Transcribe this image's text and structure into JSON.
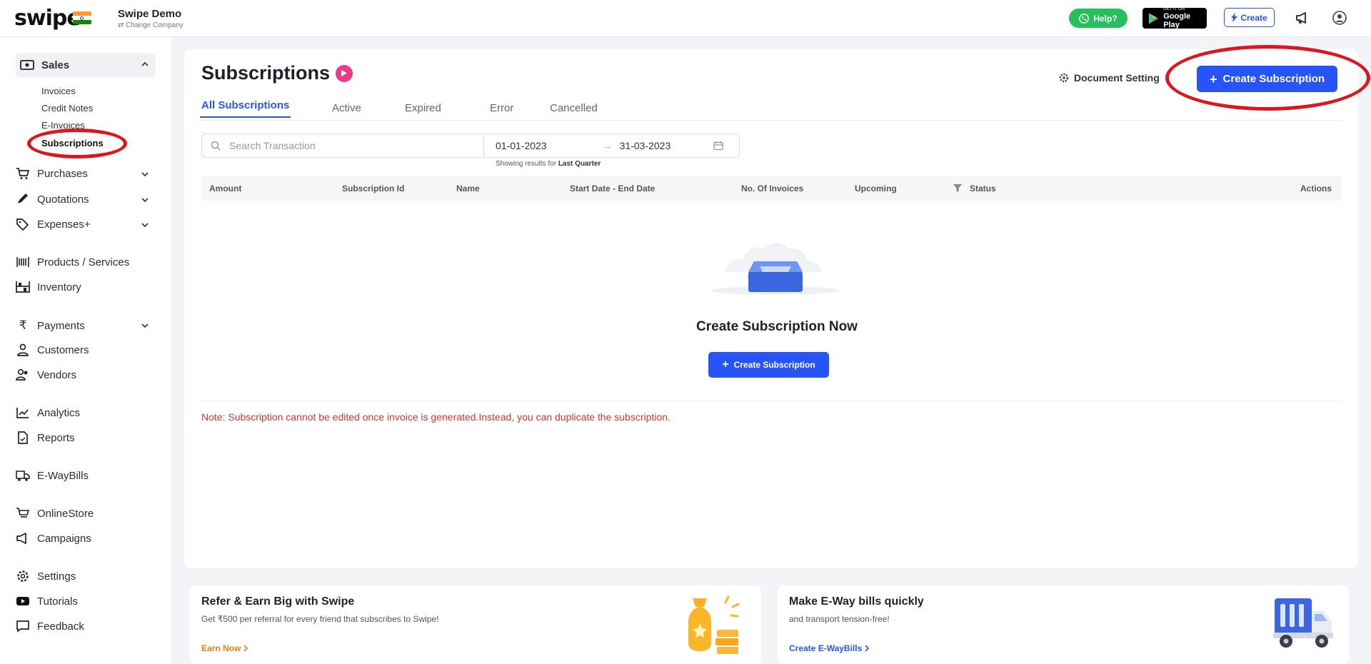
{
  "topbar": {
    "logo": "swipe",
    "company_name": "Swipe Demo",
    "change_company": "Change Company",
    "help_label": "Help?",
    "gplay_small": "GET IT ON",
    "gplay_label": "Google Play",
    "create_label": "Create"
  },
  "sidebar": {
    "sales": "Sales",
    "sales_sub": [
      "Invoices",
      "Credit Notes",
      "E-Invoices",
      "Subscriptions"
    ],
    "items": [
      {
        "label": "Purchases",
        "icon": "cart-icon"
      },
      {
        "label": "Quotations",
        "icon": "pencil-icon"
      },
      {
        "label": "Expenses+",
        "icon": "tag-icon"
      },
      {
        "label": "Products / Services",
        "icon": "barcode-icon"
      },
      {
        "label": "Inventory",
        "icon": "inventory-icon"
      },
      {
        "label": "Payments",
        "icon": "rupee-icon"
      },
      {
        "label": "Customers",
        "icon": "user-icon"
      },
      {
        "label": "Vendors",
        "icon": "users-icon"
      },
      {
        "label": "Analytics",
        "icon": "chart-icon"
      },
      {
        "label": "Reports",
        "icon": "report-icon"
      },
      {
        "label": "E-WayBills",
        "icon": "truck-icon"
      },
      {
        "label": "OnlineStore",
        "icon": "store-icon"
      },
      {
        "label": "Campaigns",
        "icon": "megaphone-icon"
      },
      {
        "label": "Settings",
        "icon": "gear-icon"
      },
      {
        "label": "Tutorials",
        "icon": "youtube-icon"
      },
      {
        "label": "Feedback",
        "icon": "feedback-icon"
      }
    ]
  },
  "page": {
    "title": "Subscriptions",
    "document_settings": "Document Setting",
    "create_subscription": "Create Subscription",
    "tabs": [
      "All Subscriptions",
      "Active",
      "Expired",
      "Error",
      "Cancelled"
    ],
    "search_placeholder": "Search Transaction",
    "date_from": "01-01-2023",
    "date_to": "31-03-2023",
    "showing_prefix": "Showing results for",
    "showing_value": "Last Quarter",
    "columns": [
      "Amount",
      "Subscription Id",
      "Name",
      "Start Date - End Date",
      "No. Of Invoices",
      "Upcoming",
      "Status",
      "Actions"
    ],
    "empty_title": "Create Subscription Now",
    "empty_button": "Create Subscription",
    "note": "Note: Subscription cannot be edited once invoice is generated.Instead, you can duplicate the subscription."
  },
  "cards": [
    {
      "title": "Refer & Earn Big with Swipe",
      "desc": "Get ₹500 per referral for every friend that subscribes to Swipe!",
      "link": "Earn Now"
    },
    {
      "title": "Make E-Way bills quickly",
      "desc": "and transport tension-free!",
      "link": "Create E-WayBills"
    }
  ],
  "colors": {
    "accent": "#2754f6",
    "note": "#e03232",
    "highlight_ring": "#e0141e"
  }
}
